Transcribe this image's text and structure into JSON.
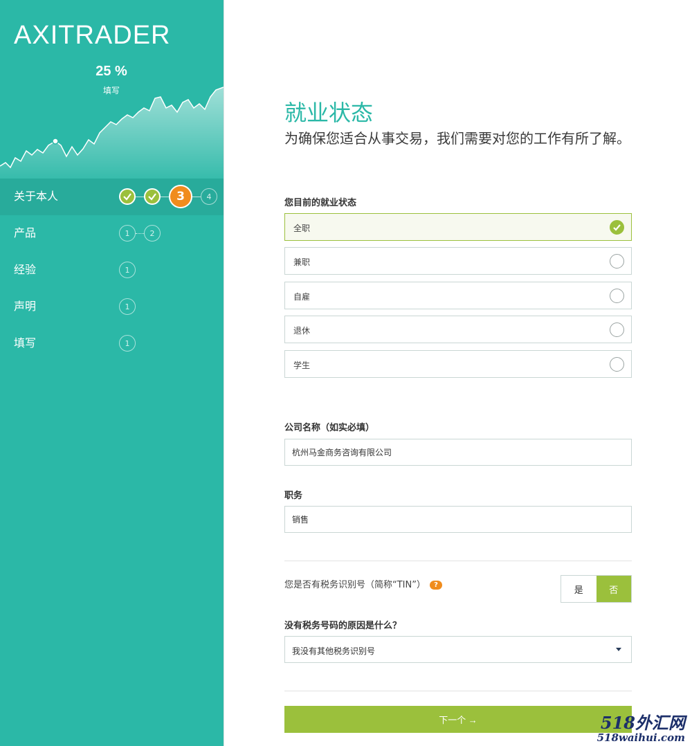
{
  "sidebar": {
    "logo": "AXITRADER",
    "progress_percent": "25 %",
    "progress_label": "填写",
    "progress_value": 25,
    "steps": [
      {
        "label": "关于本人",
        "circles": [
          "done",
          "done",
          "3",
          "4"
        ],
        "active": true
      },
      {
        "label": "产品",
        "circles": [
          "1",
          "2"
        ]
      },
      {
        "label": "经验",
        "circles": [
          "1"
        ]
      },
      {
        "label": "声明",
        "circles": [
          "1"
        ]
      },
      {
        "label": "填写",
        "circles": [
          "1"
        ]
      }
    ]
  },
  "main": {
    "title": "就业状态",
    "subtitle": "为确保您适合从事交易，我们需要对您的工作有所了解。",
    "employment_label": "您目前的就业状态",
    "options": [
      {
        "label": "全职",
        "selected": true
      },
      {
        "label": "兼职",
        "selected": false
      },
      {
        "label": "自雇",
        "selected": false
      },
      {
        "label": "退休",
        "selected": false
      },
      {
        "label": "学生",
        "selected": false
      }
    ],
    "company_label": "公司名称（如实必填）",
    "company_value": "杭州马金商务咨询有限公司",
    "position_label": "职务",
    "position_value": "销售",
    "tin_question": "您是否有税务识别号（简称“TIN”）",
    "tin_help": "?",
    "tin_yes": "是",
    "tin_no": "否",
    "tin_selected": "否",
    "reason_label": "没有税务号码的原因是什么？",
    "reason_value": "我没有其他税务识别号",
    "next_button": "下一个 →"
  },
  "watermark": {
    "line1": "518外汇网",
    "line2": "518waihui.com"
  },
  "colors": {
    "teal": "#2bb8a7",
    "green": "#9bc03c",
    "orange": "#f08c1d"
  }
}
